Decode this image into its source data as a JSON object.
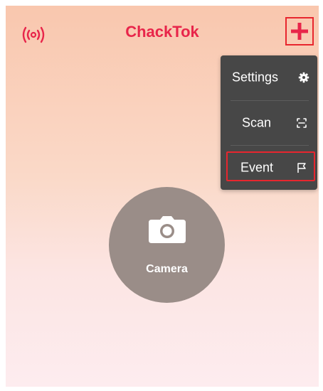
{
  "header": {
    "title": "ChackTok",
    "left_icon": "broadcast-icon",
    "right_icon": "plus-icon"
  },
  "menu": {
    "items": [
      {
        "label": "Settings",
        "icon": "gear-icon"
      },
      {
        "label": "Scan",
        "icon": "scan-icon"
      },
      {
        "label": "Event",
        "icon": "flag-icon",
        "highlighted": true
      }
    ]
  },
  "camera": {
    "label": "Camera",
    "icon": "camera-icon"
  },
  "colors": {
    "accent": "#e8254a",
    "menu_background": "#474747",
    "highlight_border": "#e8262e",
    "camera_circle": "#9a8d88"
  }
}
